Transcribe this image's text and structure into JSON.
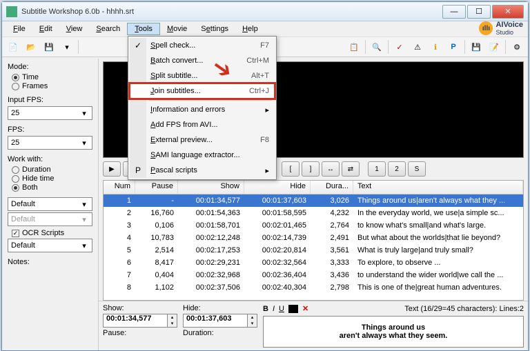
{
  "window": {
    "title": "Subtitle Workshop 6.0b - hhhh.srt"
  },
  "menubar": {
    "items": [
      "File",
      "Edit",
      "View",
      "Search",
      "Tools",
      "Movie",
      "Settings",
      "Help"
    ],
    "active_index": 4
  },
  "tools_menu": {
    "items": [
      {
        "label": "Spell check...",
        "shortcut": "F7",
        "icon": "✓"
      },
      {
        "label": "Batch convert...",
        "shortcut": "Ctrl+M"
      },
      {
        "label": "Split subtitle...",
        "shortcut": "Alt+T"
      },
      {
        "label": "Join subtitles...",
        "shortcut": "Ctrl+J",
        "highlight": true
      },
      {
        "sep": true
      },
      {
        "label": "Information and errors",
        "submenu": true
      },
      {
        "label": "Add FPS from AVI..."
      },
      {
        "label": "External preview...",
        "shortcut": "F8"
      },
      {
        "label": "SAMI language extractor..."
      },
      {
        "label": "Pascal scripts",
        "submenu": true,
        "icon": "P"
      }
    ]
  },
  "sidebar": {
    "mode_label": "Mode:",
    "mode_time": "Time",
    "mode_frames": "Frames",
    "mode_selected": "time",
    "input_fps_label": "Input FPS:",
    "input_fps_value": "25",
    "fps_label": "FPS:",
    "fps_value": "25",
    "workwith_label": "Work with:",
    "ww_duration": "Duration",
    "ww_hide": "Hide time",
    "ww_both": "Both",
    "ww_selected": "both",
    "combo1": "Default",
    "combo2": "Default",
    "ocr_label": "OCR Scripts",
    "ocr_checked": true,
    "combo3": "Default",
    "notes_label": "Notes:"
  },
  "table": {
    "headers": {
      "num": "Num",
      "pause": "Pause",
      "show": "Show",
      "hide": "Hide",
      "dura": "Dura...",
      "text": "Text"
    },
    "rows": [
      {
        "num": "1",
        "pause": "-",
        "show": "00:01:34,577",
        "hide": "00:01:37,603",
        "dura": "3,026",
        "text": "Things around us|aren't always what they ...",
        "sel": true
      },
      {
        "num": "2",
        "pause": "16,760",
        "show": "00:01:54,363",
        "hide": "00:01:58,595",
        "dura": "4,232",
        "text": "In the everyday world, we use|a simple sc..."
      },
      {
        "num": "3",
        "pause": "0,106",
        "show": "00:01:58,701",
        "hide": "00:02:01,465",
        "dura": "2,764",
        "text": "to know what's small|and what's large."
      },
      {
        "num": "4",
        "pause": "10,783",
        "show": "00:02:12,248",
        "hide": "00:02:14,739",
        "dura": "2,491",
        "text": "But what about the worlds|that lie beyond?"
      },
      {
        "num": "5",
        "pause": "2,514",
        "show": "00:02:17,253",
        "hide": "00:02:20,814",
        "dura": "3,561",
        "text": "What is truly large|and truly small?"
      },
      {
        "num": "6",
        "pause": "8,417",
        "show": "00:02:29,231",
        "hide": "00:02:32,564",
        "dura": "3,333",
        "text": "To explore, to observe ..."
      },
      {
        "num": "7",
        "pause": "0,404",
        "show": "00:02:32,968",
        "hide": "00:02:36,404",
        "dura": "3,436",
        "text": "to understand the wider world|we call the ..."
      },
      {
        "num": "8",
        "pause": "1,102",
        "show": "00:02:37,506",
        "hide": "00:02:40,304",
        "dura": "2,798",
        "text": "This is one of the|great human adventures."
      }
    ]
  },
  "bottom": {
    "show_label": "Show:",
    "show_value": "00:01:34,577",
    "hide_label": "Hide:",
    "hide_value": "00:01:37,603",
    "pause_label": "Pause:",
    "duration_label": "Duration:",
    "stats": "Text (16/29=45 characters): Lines:2",
    "preview_line1": "Things around us",
    "preview_line2": "aren't always what they seem."
  },
  "logo": {
    "name": "AIVoice",
    "sub": "Studio"
  }
}
